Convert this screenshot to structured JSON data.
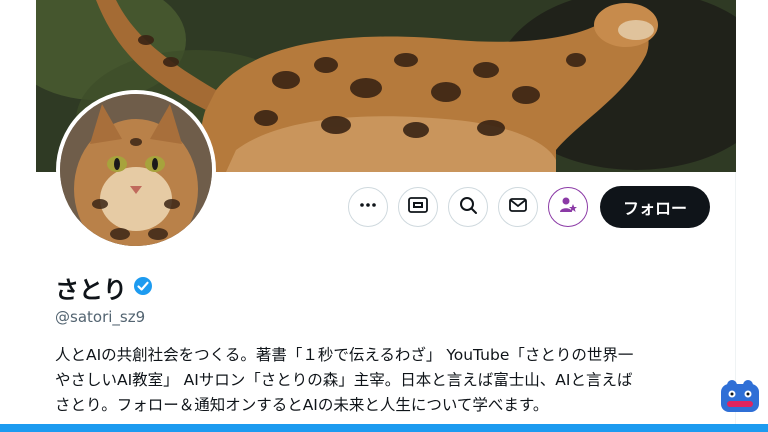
{
  "profile": {
    "name": "さとり",
    "handle": "@satori_sz9",
    "bio_line1": "人とAIの共創社会をつくる。著書「１秒で伝えるわざ」 YouTube「さとりの世界一",
    "bio_line2": "やさしいAI教室」 AIサロン「さとりの森」主宰。日本と言えば富士山、AIと言えば",
    "bio_line3": "さとり。フォロー＆通知オンするとAIの未来と人生について学べます。"
  },
  "actions": {
    "more_icon": "more-icon",
    "grok_icon": "grok-icon",
    "search_icon": "search-icon",
    "message_icon": "message-icon",
    "subscribe_icon": "subscribe-icon",
    "follow_label": "フォロー"
  },
  "colors": {
    "accent": "#1d9bf0",
    "text": "#0f1419",
    "muted": "#536471",
    "subscribe": "#8b3aa6"
  }
}
